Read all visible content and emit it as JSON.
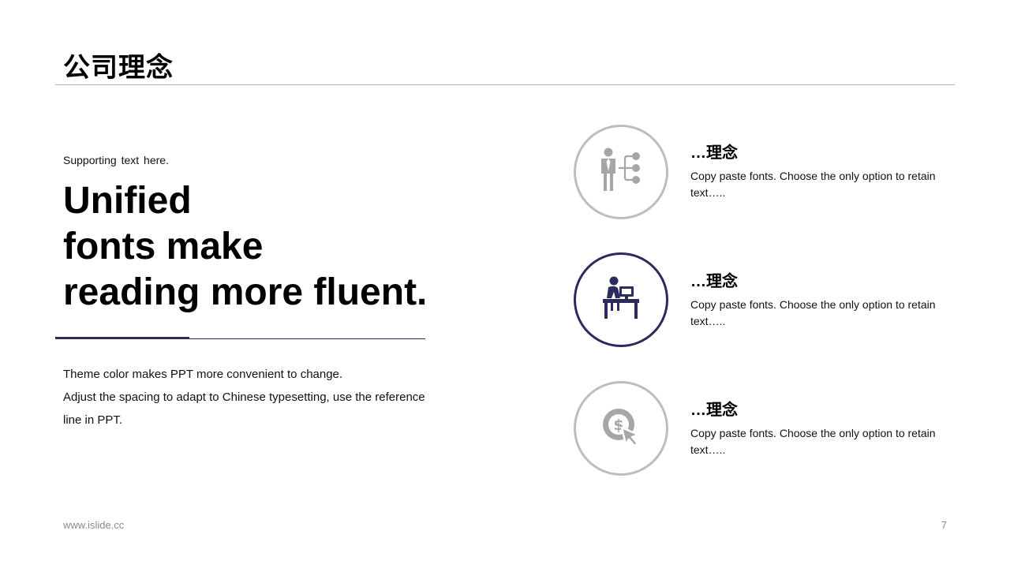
{
  "slide": {
    "title": "公司理念",
    "supporting_text": "Supporting text here.",
    "headline": [
      "Unified",
      "fonts make",
      "reading more fluent."
    ],
    "body_lines": [
      "Theme color makes PPT more convenient to change.",
      "Adjust the spacing to adapt to Chinese typesetting, use the reference",
      "line in PPT."
    ],
    "items": [
      {
        "icon": "flowchart-person-icon",
        "title": "…理念",
        "text": "Copy paste fonts. Choose the only option to retain text….."
      },
      {
        "icon": "person-at-desk-icon",
        "title": "…理念",
        "text": "Copy paste fonts. Choose the only option to retain text….."
      },
      {
        "icon": "dollar-click-icon",
        "title": "…理念",
        "text": "Copy paste fonts. Choose the only option to retain text….."
      }
    ],
    "footer_url": "www.islide.cc",
    "page_number": "7"
  },
  "colors": {
    "accent": "#2d2a5c",
    "icon_inactive": "#a6a6a6",
    "ring_inactive": "#bdbdbd",
    "rule": "#b5b5b5"
  }
}
